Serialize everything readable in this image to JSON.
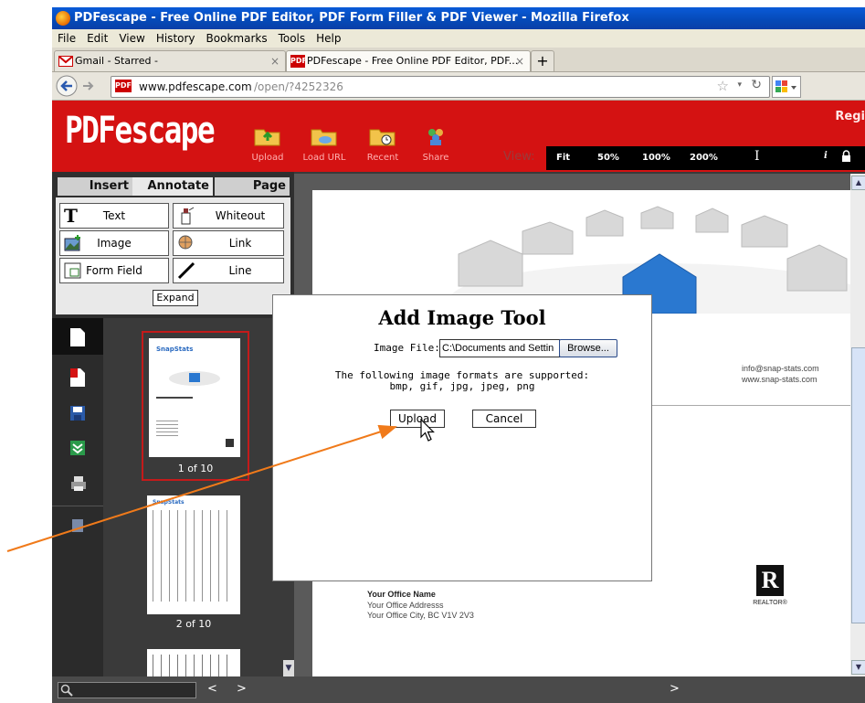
{
  "window": {
    "title": "PDFescape - Free Online PDF Editor, PDF Form Filler & PDF Viewer - Mozilla Firefox"
  },
  "menu": [
    "File",
    "Edit",
    "View",
    "History",
    "Bookmarks",
    "Tools",
    "Help"
  ],
  "tabs": [
    {
      "label": "Gmail - Starred -"
    },
    {
      "label": "PDFescape - Free Online PDF Editor, PDF...",
      "icon_text": "PDF"
    }
  ],
  "tab_new": "+",
  "address": {
    "domain": "www.pdfescape.com",
    "path": "/open/?4252326",
    "favicon_text": "PDF"
  },
  "app": {
    "logo": "PDFescape",
    "register": "Regi",
    "header_buttons": [
      "Upload",
      "Load URL",
      "Recent",
      "Share"
    ],
    "view": {
      "label": "View:",
      "options": [
        "Fit",
        "50%",
        "100%",
        "200%"
      ],
      "cursor_tool": "I",
      "info": "i"
    }
  },
  "panel_tabs": [
    "Insert",
    "Annotate",
    "Page"
  ],
  "tools": [
    {
      "label": "Text"
    },
    {
      "label": "Whiteout"
    },
    {
      "label": "Image"
    },
    {
      "label": "Link"
    },
    {
      "label": "Form Field"
    },
    {
      "label": "Line"
    }
  ],
  "expand": "Expand",
  "thumbnails": [
    {
      "page_label": "1 of 10",
      "brand": "SnapStats"
    },
    {
      "page_label": "2 of 10",
      "brand": "SnapStats"
    }
  ],
  "document": {
    "contact": [
      "info@snap-stats.com",
      "www.snap-stats.com"
    ],
    "office": [
      "Your Office Name",
      "Your Office Addresss",
      "Your Office City, BC  V1V 2V3"
    ],
    "realtor_mark": "R",
    "realtor_text": "REALTOR®"
  },
  "modal": {
    "title": "Add Image Tool",
    "file_label": "Image File:",
    "file_value": "C:\\Documents and Settin",
    "browse": "Browse...",
    "info_line1": "The following image formats are supported:",
    "info_line2": "bmp, gif, jpg, jpeg, png",
    "upload": "Upload",
    "cancel": "Cancel"
  },
  "bottom_nav": {
    "prev": "<",
    "next": ">",
    "next_right": ">"
  },
  "colors": {
    "brand_red": "#d41212",
    "annotation_arrow": "#f07a1a"
  }
}
